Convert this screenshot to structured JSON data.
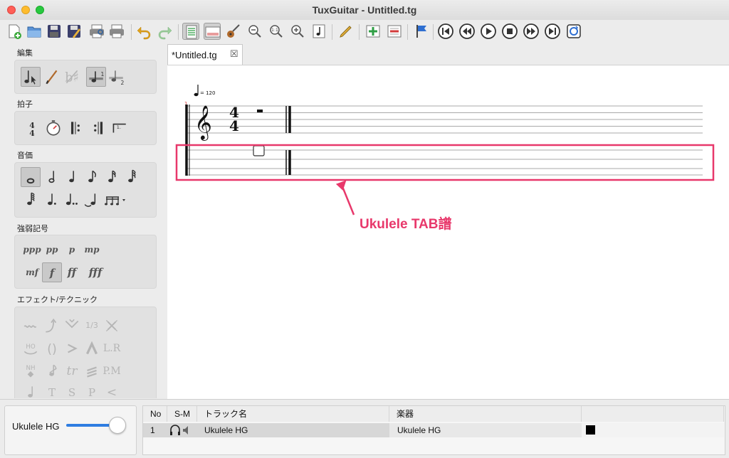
{
  "window": {
    "title": "TuxGuitar - Untitled.tg"
  },
  "toolbar": {
    "buttons": [
      "new-file",
      "open-file",
      "save-file",
      "save-as-file",
      "print-preview",
      "print",
      "undo",
      "redo",
      "page-view",
      "linear-view",
      "guitar-fretboard",
      "zoom-out",
      "zoom-reset",
      "zoom-in",
      "note-view",
      "edit-pencil",
      "add-track",
      "remove-track",
      "marker-flag",
      "transport-first",
      "transport-previous",
      "transport-play",
      "transport-stop",
      "transport-next",
      "transport-last",
      "transport-loop"
    ]
  },
  "sidebar": {
    "sections": [
      {
        "label": "編集"
      },
      {
        "label": "拍子"
      },
      {
        "label": "音価"
      },
      {
        "label": "強弱記号"
      },
      {
        "label": "エフェクト/テクニック"
      }
    ],
    "dynamics": [
      "ppp",
      "pp",
      "p",
      "mp",
      "mf",
      "f",
      "ff",
      "fff"
    ],
    "effects_text": [
      "1/3",
      "L.R",
      "tr",
      "P.M",
      "T",
      "S",
      "P",
      "<"
    ]
  },
  "tabs": [
    {
      "label": "*Untitled.tg",
      "close": "☒"
    }
  ],
  "score": {
    "measure_number": "1",
    "tempo": "= 120",
    "time_signature": {
      "top": "4",
      "bottom": "4"
    },
    "annotation": "Ukulele TAB譜"
  },
  "track_panel": {
    "track_name": "Ukulele HG",
    "volume": 1.0,
    "columns": [
      "No",
      "S-M",
      "トラック名",
      "楽器"
    ],
    "rows": [
      {
        "no": "1",
        "name": "Ukulele HG",
        "instrument": "Ukulele HG",
        "color": "#000000"
      }
    ]
  },
  "colors": {
    "annotation": "#e8386b",
    "slider": "#2f7de1"
  }
}
